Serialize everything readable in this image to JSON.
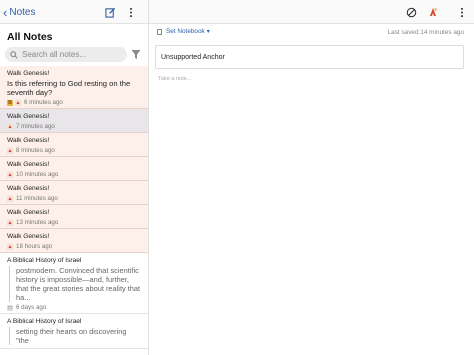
{
  "topbar": {
    "back_label": "Notes",
    "compose_icon": "compose-icon",
    "more_icon": "more-vertical-icon",
    "right_icons": [
      "block-icon",
      "walk-genesis-icon",
      "more-vertical-icon"
    ]
  },
  "sidebar": {
    "title": "All Notes",
    "search_placeholder": "Search all notes...",
    "filter_icon": "filter-icon",
    "notes": [
      {
        "title": "Walk Genesis!",
        "body": "Is this referring to God resting on the seventh day?",
        "badges": [
          "bible-icon",
          "walk-icon"
        ],
        "time": "6 minutes ago"
      },
      {
        "title": "Walk Genesis!",
        "badges": [
          "walk-icon"
        ],
        "time": "7 minutes ago"
      },
      {
        "title": "Walk Genesis!",
        "badges": [
          "walk-icon"
        ],
        "time": "8 minutes ago"
      },
      {
        "title": "Walk Genesis!",
        "badges": [
          "walk-icon"
        ],
        "time": "10 minutes ago"
      },
      {
        "title": "Walk Genesis!",
        "badges": [
          "walk-icon"
        ],
        "time": "11 minutes ago"
      },
      {
        "title": "Walk Genesis!",
        "badges": [
          "walk-icon"
        ],
        "time": "13 minutes ago"
      },
      {
        "title": "Walk Genesis!",
        "badges": [
          "walk-icon"
        ],
        "time": "18 hours ago"
      },
      {
        "title": "A Biblical History of Israel",
        "excerpt": "postmodern. Convinced that scientific history is impossible—and, further, that the great stories about reality that ha...",
        "badges": [
          "book-icon"
        ],
        "time": "6 days ago"
      },
      {
        "title": "A Biblical History of Israel",
        "excerpt": "setting their hearts on discovering \"the",
        "badges": [],
        "time": ""
      }
    ]
  },
  "main": {
    "notebook_label": "Set Notebook",
    "saved_label": "Last saved 14 minutes ago",
    "anchor_label": "Unsupported Anchor",
    "take_note_placeholder": "Take a note..."
  },
  "colors": {
    "accent": "#2f5fa6",
    "note_bg": "#fdf0ea",
    "selected_bg": "#e8e6e8"
  }
}
